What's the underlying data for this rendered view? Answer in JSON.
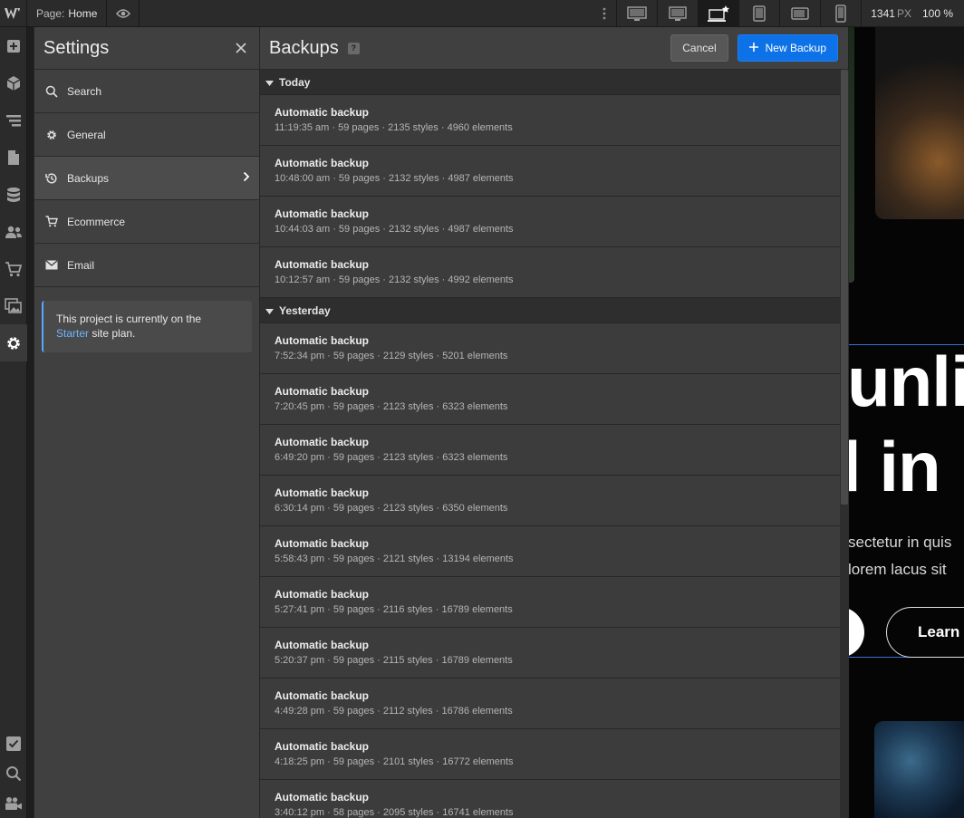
{
  "topbar": {
    "page_prefix": "Page:",
    "page_name": "Home",
    "width_value": "1341",
    "width_unit": "PX",
    "zoom": "100 %"
  },
  "settings": {
    "title": "Settings",
    "items": [
      {
        "label": "Search",
        "icon": "search-icon"
      },
      {
        "label": "General",
        "icon": "gear-icon"
      },
      {
        "label": "Backups",
        "icon": "history-icon",
        "active": true
      },
      {
        "label": "Ecommerce",
        "icon": "cart-icon"
      },
      {
        "label": "Email",
        "icon": "mail-icon"
      }
    ],
    "plan_text_1": "This project is currently on the",
    "plan_link": "Starter",
    "plan_text_2": " site plan."
  },
  "backups": {
    "title": "Backups",
    "help": "?",
    "cancel_label": "Cancel",
    "new_label": "New Backup",
    "groups": [
      {
        "label": "Today",
        "rows": [
          {
            "title": "Automatic backup",
            "meta": "11:19:35 am · 59 pages · 2135 styles · 4960 elements"
          },
          {
            "title": "Automatic backup",
            "meta": "10:48:00 am · 59 pages · 2132 styles · 4987 elements"
          },
          {
            "title": "Automatic backup",
            "meta": "10:44:03 am · 59 pages · 2132 styles · 4987 elements"
          },
          {
            "title": "Automatic backup",
            "meta": "10:12:57 am · 59 pages · 2132 styles · 4992 elements"
          }
        ]
      },
      {
        "label": "Yesterday",
        "rows": [
          {
            "title": "Automatic backup",
            "meta": "7:52:34 pm · 59 pages · 2129 styles · 5201 elements"
          },
          {
            "title": "Automatic backup",
            "meta": "7:20:45 pm · 59 pages · 2123 styles · 6323 elements"
          },
          {
            "title": "Automatic backup",
            "meta": "6:49:20 pm · 59 pages · 2123 styles · 6323 elements"
          },
          {
            "title": "Automatic backup",
            "meta": "6:30:14 pm · 59 pages · 2123 styles · 6350 elements"
          },
          {
            "title": "Automatic backup",
            "meta": "5:58:43 pm · 59 pages · 2121 styles · 13194 elements"
          },
          {
            "title": "Automatic backup",
            "meta": "5:27:41 pm · 59 pages · 2116 styles · 16789 elements"
          },
          {
            "title": "Automatic backup",
            "meta": "5:20:37 pm · 59 pages · 2115 styles · 16789 elements"
          },
          {
            "title": "Automatic backup",
            "meta": "4:49:28 pm · 59 pages · 2112 styles · 16786 elements"
          },
          {
            "title": "Automatic backup",
            "meta": "4:18:25 pm · 59 pages · 2101 styles · 16772 elements"
          },
          {
            "title": "Automatic backup",
            "meta": "3:40:12 pm · 58 pages · 2095 styles · 16741 elements"
          }
        ]
      }
    ]
  },
  "canvas": {
    "hero_line_1": "unli",
    "hero_line_2": "l in",
    "body_line_1": "sectetur in quis",
    "body_line_2": "lorem lacus sit",
    "learn_button": "Learn"
  },
  "colors": {
    "accent": "#0d72e8",
    "link": "#6fb3ff"
  }
}
